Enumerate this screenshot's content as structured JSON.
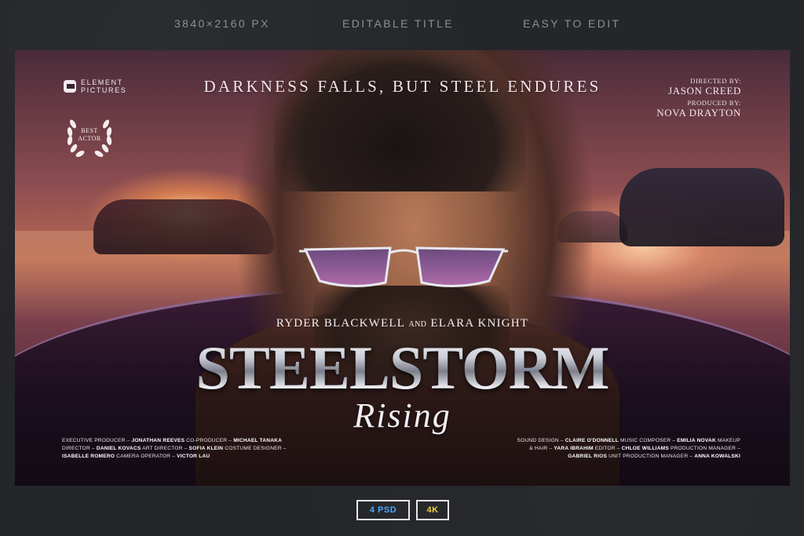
{
  "top_bar": {
    "items": [
      "3840×2160 PX",
      "EDITABLE TITLE",
      "EASY TO EDIT"
    ]
  },
  "poster": {
    "studio": {
      "line1": "ELEMENT",
      "line2": "PICTURES"
    },
    "award": {
      "line1": "BEST",
      "line2": "ACTOR"
    },
    "tagline": "DARKNESS FALLS, BUT STEEL ENDURES",
    "credits_top": {
      "directed_label": "DIRECTED BY:",
      "director": "JASON CREED",
      "produced_label": "PRODUCED BY:",
      "producer": "NOVA DRAYTON"
    },
    "actors": {
      "actor1": "RYDER BLACKWELL",
      "and": "AND",
      "actor2": "ELARA KNIGHT"
    },
    "title": "STEELSTORM",
    "subtitle": "Rising",
    "crew_left": {
      "line1_a": "EXECUTIVE PRODUCER – ",
      "line1_b": "JONATHAN REEVES",
      "line1_c": "   CO-PRODUCER – ",
      "line1_d": "MICHAEL TANAKA",
      "line2_a": "DIRECTOR – ",
      "line2_b": "DANIEL KOVACS",
      "line2_c": "   ART DIRECTOR – ",
      "line2_d": "SOFIA KLEIN",
      "line2_e": "   COSTUME DESIGNER –",
      "line3_a": "ISABELLE ROMERO",
      "line3_b": "   CAMERA OPERATOR – ",
      "line3_c": "VICTOR LAU"
    },
    "crew_right": {
      "line1_a": "SOUND DESIGN – ",
      "line1_b": "CLAIRE O'DONNELL",
      "line1_c": "   MUSIC COMPOSER – ",
      "line1_d": "EMILIA NOVAK",
      "line1_e": "   MAKEUP",
      "line2_a": "& HAIR – ",
      "line2_b": "YARA IBRAHIM",
      "line2_c": "   EDITOR – ",
      "line2_d": "CHLOE WILLIAMS",
      "line2_e": "   PRODUCTION MANAGER –",
      "line3_a": "GABRIEL RIOS",
      "line3_b": "   UNIT PRODUCTION MANAGER – ",
      "line3_c": "ANNA KOWALSKI"
    }
  },
  "badges": {
    "psd": "4 PSD",
    "res": "4K"
  },
  "colors": {
    "background": "#24262a",
    "badge_psd": "#4ea8ff",
    "badge_res": "#f5d53a"
  }
}
